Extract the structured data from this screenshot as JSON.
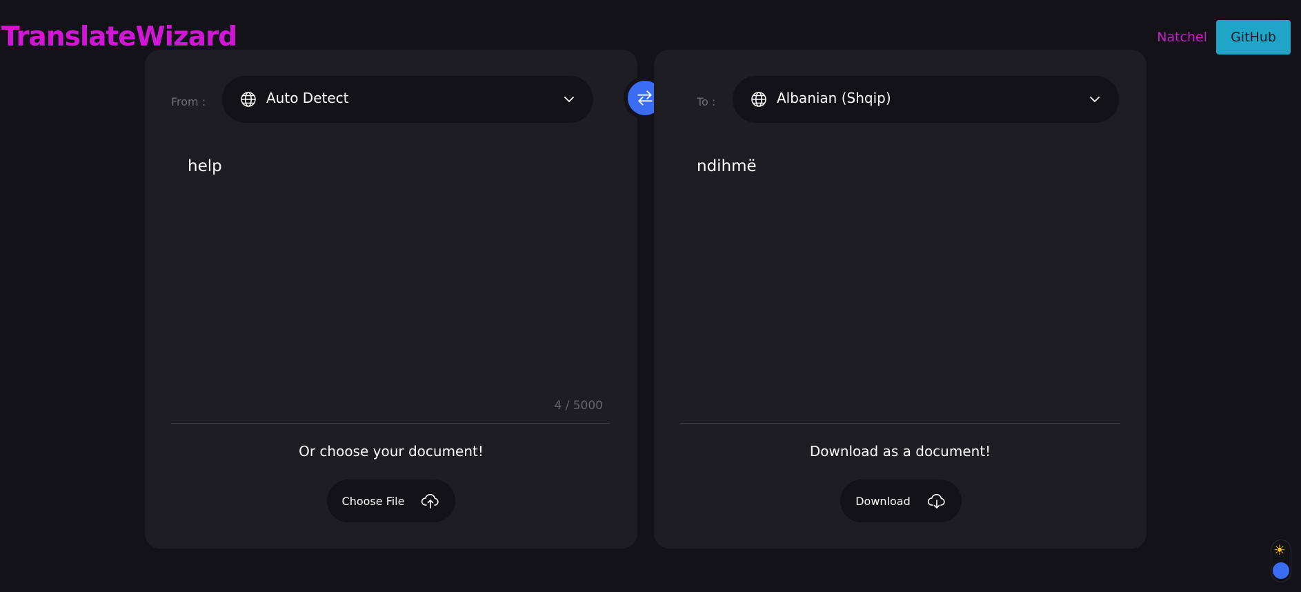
{
  "app": {
    "title": "TranslateWizard"
  },
  "nav": {
    "author_link": "Natchel",
    "github_label": "GitHub"
  },
  "source": {
    "label": "From :",
    "language": "Auto Detect",
    "text": "help",
    "char_count": "4 / 5000",
    "doc_caption": "Or choose your document!",
    "file_button": "Choose File"
  },
  "target": {
    "label": "To :",
    "language": "Albanian (Shqip)",
    "text": "ndihmë",
    "doc_caption": "Download as a document!",
    "download_button": "Download"
  },
  "theme_toggle": {
    "icon": "☀"
  },
  "colors": {
    "background": "#131218",
    "panel": "#1e1d23",
    "brand": "#d216d6",
    "accent_blue": "#3a6cf4",
    "github": "#1ea5c8"
  },
  "icons": [
    "globe-icon",
    "chevron-down-icon",
    "swap-icon",
    "cloud-upload-icon",
    "cloud-download-icon",
    "sun-icon"
  ]
}
